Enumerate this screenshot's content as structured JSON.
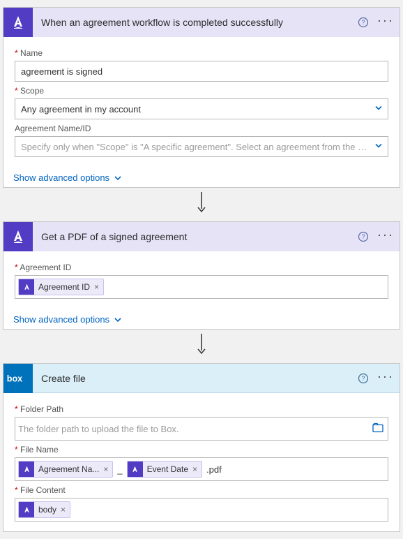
{
  "steps": [
    {
      "app": "adobe",
      "title": "When an agreement workflow is completed successfully",
      "fields": {
        "name_label": "Name",
        "name_value": "agreement is signed",
        "scope_label": "Scope",
        "scope_value": "Any agreement in my account",
        "agreement_label": "Agreement Name/ID",
        "agreement_placeholder": "Specify only when \"Scope\" is \"A specific agreement\". Select an agreement from the list or en"
      },
      "show_advanced": "Show advanced options"
    },
    {
      "app": "adobe",
      "title": "Get a PDF of a signed agreement",
      "fields": {
        "agreementid_label": "Agreement ID",
        "agreementid_token": "Agreement ID"
      },
      "show_advanced": "Show advanced options"
    },
    {
      "app": "box",
      "title": "Create file",
      "fields": {
        "folder_label": "Folder Path",
        "folder_placeholder": "The folder path to upload the file to Box.",
        "filename_label": "File Name",
        "filename_tokens": [
          "Agreement Na...",
          "Event Date"
        ],
        "filename_between": "_",
        "filename_suffix": ".pdf",
        "filecontent_label": "File Content",
        "filecontent_token": "body"
      }
    }
  ]
}
